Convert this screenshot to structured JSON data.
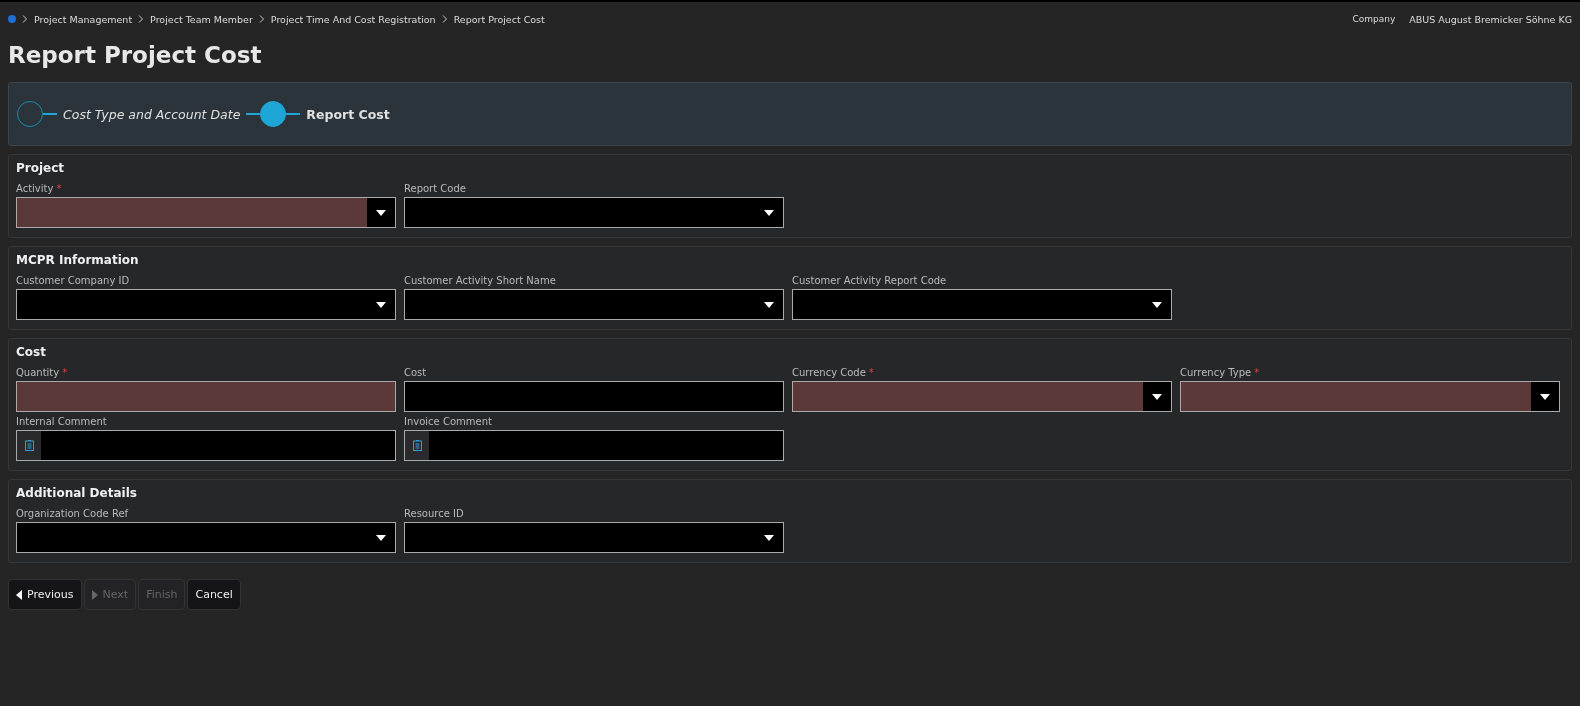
{
  "breadcrumbs": [
    "Project Management",
    "Project Team Member",
    "Project Time And Cost Registration",
    "Report Project Cost"
  ],
  "company": {
    "label": "Company",
    "value": "ABUS August Bremicker Söhne KG"
  },
  "title": "Report Project Cost",
  "steps": [
    {
      "label": "Cost Type and Account Date",
      "selected": false
    },
    {
      "label": "Report Cost",
      "selected": true
    }
  ],
  "sections": [
    {
      "title": "Project",
      "rows": [
        [
          {
            "label": "Activity",
            "kind": "lookup",
            "required": true,
            "marker": "*"
          },
          {
            "label": "Report Code",
            "kind": "lookup",
            "required": false
          }
        ]
      ]
    },
    {
      "title": "MCPR Information",
      "rows": [
        [
          {
            "label": "Customer Company ID",
            "kind": "lookup",
            "required": false
          },
          {
            "label": "Customer Activity Short Name",
            "kind": "lookup",
            "required": false
          },
          {
            "label": "Customer Activity Report Code",
            "kind": "lookup",
            "required": false
          }
        ]
      ]
    },
    {
      "title": "Cost",
      "rows": [
        [
          {
            "label": "Quantity",
            "kind": "text",
            "required": true,
            "marker": "*"
          },
          {
            "label": "Cost",
            "kind": "text",
            "required": false
          },
          {
            "label": "Currency Code",
            "kind": "lookup",
            "required": true,
            "marker": "*"
          },
          {
            "label": "Currency Type",
            "kind": "lookup",
            "required": true,
            "marker": "*"
          }
        ],
        [
          {
            "label": "Internal Comment",
            "kind": "comment",
            "required": false
          },
          {
            "label": "Invoice Comment",
            "kind": "comment",
            "required": false
          }
        ]
      ]
    },
    {
      "title": "Additional Details",
      "rows": [
        [
          {
            "label": "Organization Code Ref",
            "kind": "lookup",
            "required": false
          },
          {
            "label": "Resource ID",
            "kind": "lookup",
            "required": false
          }
        ]
      ]
    }
  ],
  "buttons": [
    {
      "label": "Previous",
      "kind": "back",
      "disabled": false
    },
    {
      "label": "Next",
      "kind": "forward",
      "disabled": true
    },
    {
      "label": "Finish",
      "kind": "plain",
      "disabled": true
    },
    {
      "label": "Cancel",
      "kind": "plain",
      "disabled": false
    }
  ]
}
